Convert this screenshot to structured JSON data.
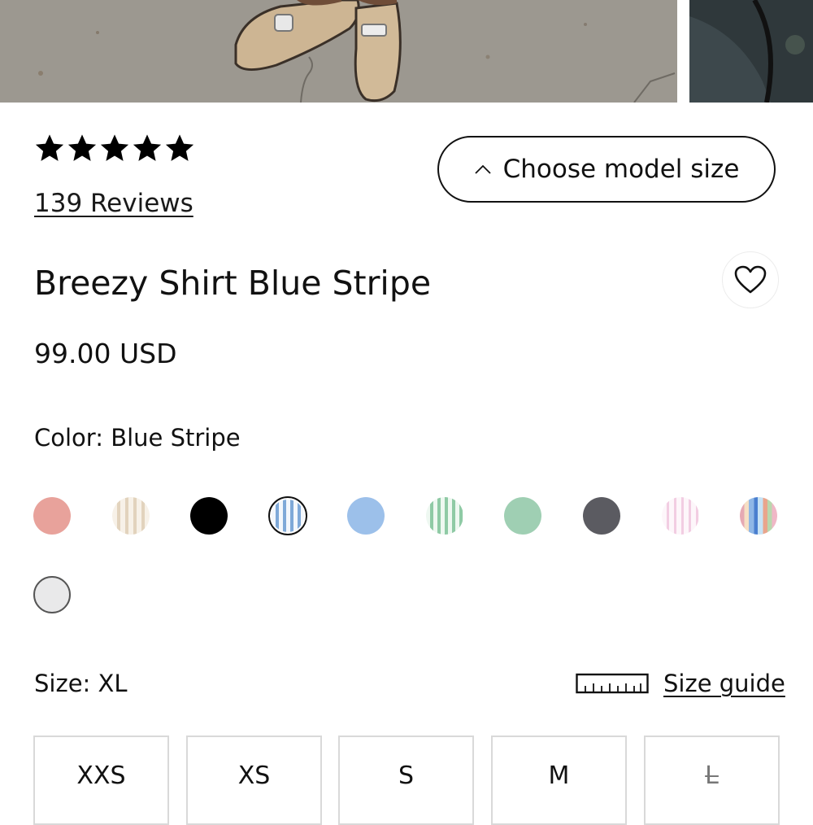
{
  "gallery": {
    "photos": [
      "main-photo",
      "side-photo"
    ]
  },
  "rating": {
    "stars": 5,
    "max_stars": 5,
    "reviews_label": "139 Reviews"
  },
  "model_size": {
    "label": "Choose model size",
    "icon": "chevron-up-icon"
  },
  "product": {
    "title": "Breezy Shirt Blue Stripe",
    "price": "99.00 USD",
    "wishlist_icon": "heart-icon"
  },
  "color": {
    "label": "Color: Blue Stripe",
    "swatches": [
      {
        "name": "pink",
        "fill": "#e8a29b"
      },
      {
        "name": "beige-stripe",
        "fill": "stripe:#e4d6c2"
      },
      {
        "name": "black",
        "fill": "#000000"
      },
      {
        "name": "blue-stripe",
        "fill": "stripe:#7fa9d8",
        "selected": true
      },
      {
        "name": "light-blue",
        "fill": "#9cc0ea"
      },
      {
        "name": "green-stripe",
        "fill": "stripe:#8fcaa5"
      },
      {
        "name": "mint",
        "fill": "#9fcfb3"
      },
      {
        "name": "charcoal",
        "fill": "#5b5b61"
      },
      {
        "name": "pink-stripe",
        "fill": "stripe:#f3cfe3"
      },
      {
        "name": "multi-stripe",
        "fill": "multistripe"
      },
      {
        "name": "white",
        "fill": "#e9e9ea",
        "outlined": true
      }
    ]
  },
  "size": {
    "label": "Size: XL",
    "guide_label": "Size guide",
    "guide_icon": "ruler-icon",
    "options": [
      {
        "label": "XXS",
        "available": true
      },
      {
        "label": "XS",
        "available": true
      },
      {
        "label": "S",
        "available": true
      },
      {
        "label": "M",
        "available": true
      },
      {
        "label": "L",
        "available": false
      }
    ]
  }
}
